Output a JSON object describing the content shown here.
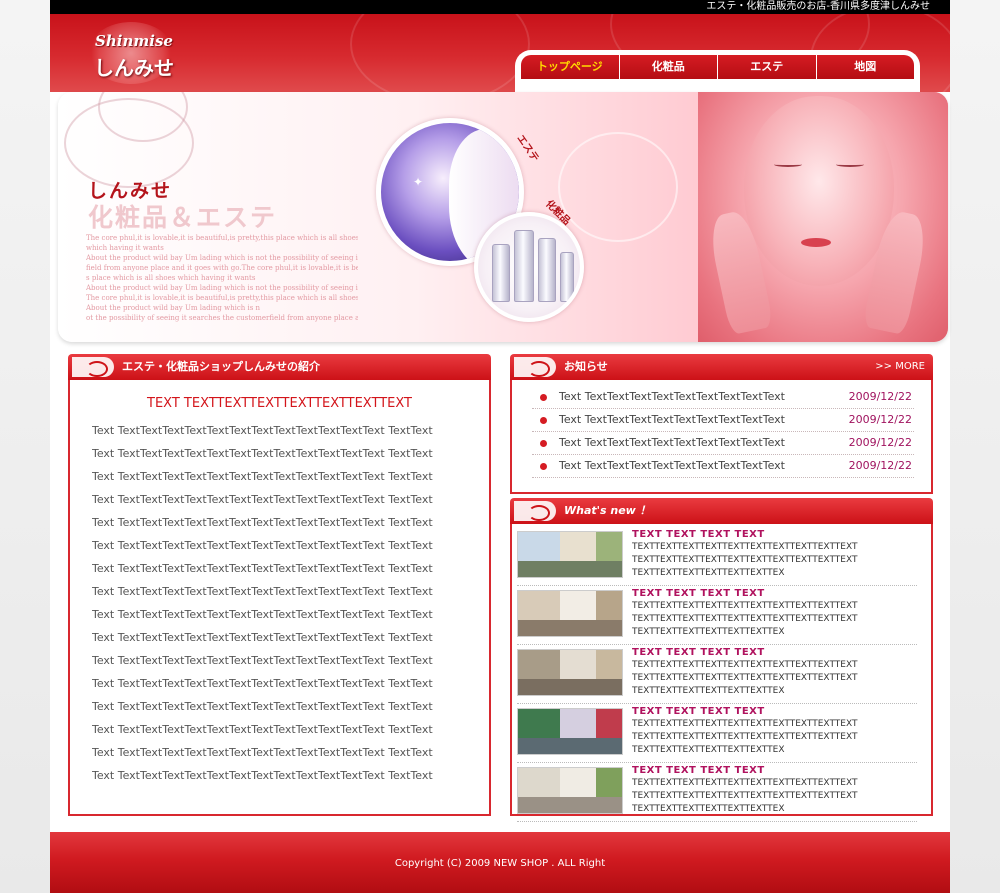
{
  "topbar": {
    "tagline": "エステ・化粧品販売のお店-香川県多度津しんみせ"
  },
  "logo": {
    "en": "Shinmise",
    "jp": "しんみせ"
  },
  "nav": {
    "items": [
      {
        "label": "トップページ"
      },
      {
        "label": "化粧品"
      },
      {
        "label": "エステ"
      },
      {
        "label": "地図"
      }
    ]
  },
  "hero": {
    "title": "しんみせ",
    "subtitle": "化粧品＆エステ",
    "tag_este": "エステ",
    "tag_kesho": "化粧品",
    "lines": [
      "The core phul,it is lovable,it is beautiful,is pretty,this place which is all shoes",
      " which having it wants",
      "About the product wild bay Um lading which is not the possibility of seeing i",
      "field from anyone place and it goes with go.The core phul,it is lovable,it is beautiful,i",
      "s place which is all shoes which having it wants",
      "About the product wild bay Um lading which is not the possibility of seeing it search",
      "The core phul,it is lovable,it is beautiful,is pretty,this place which is all shoes which",
      "About the product wild bay Um lading which is n",
      "ot the possibility of seeing it searches the  customerfield from anyone place and it go"
    ]
  },
  "intro": {
    "heading": "エステ・化粧品ショップしんみせの紹介",
    "title": "TEXT TEXTTEXTTEXTTEXTTEXTTEXTTEXT",
    "lines": [
      "Text TextTextTextTextTextTextTextTextTextTextTextText TextText",
      "Text TextTextTextTextTextTextTextTextTextTextTextText TextText",
      "Text TextTextTextTextTextTextTextTextTextTextTextText TextText",
      "Text TextTextTextTextTextTextTextTextTextTextTextText TextText",
      "Text TextTextTextTextTextTextTextTextTextTextTextText TextText",
      "Text TextTextTextTextTextTextTextTextTextTextTextText TextText",
      "Text TextTextTextTextTextTextTextTextTextTextTextText TextText",
      "Text TextTextTextTextTextTextTextTextTextTextTextText TextText",
      "Text TextTextTextTextTextTextTextTextTextTextTextText TextText",
      "Text TextTextTextTextTextTextTextTextTextTextTextText TextText",
      "Text TextTextTextTextTextTextTextTextTextTextTextText TextText",
      "Text TextTextTextTextTextTextTextTextTextTextTextText TextText",
      "Text TextTextTextTextTextTextTextTextTextTextTextText TextText",
      "Text TextTextTextTextTextTextTextTextTextTextTextText TextText",
      "Text TextTextTextTextTextTextTextTextTextTextTextText TextText",
      "Text TextTextTextTextTextTextTextTextTextTextTextText TextText"
    ]
  },
  "news": {
    "heading": "お知らせ",
    "more": ">> MORE",
    "items": [
      {
        "text": "Text TextTextTextTextTextTextTextTextText",
        "date": "2009/12/22"
      },
      {
        "text": "Text TextTextTextTextTextTextTextTextText",
        "date": "2009/12/22"
      },
      {
        "text": "Text TextTextTextTextTextTextTextTextText",
        "date": "2009/12/22"
      },
      {
        "text": "Text TextTextTextTextTextTextTextTextText",
        "date": "2009/12/22"
      }
    ]
  },
  "whatsnew": {
    "heading": "What's new ！",
    "items": [
      {
        "title": "TEXT TEXT TEXT TEXT",
        "l1": "TEXTTEXTTEXTTEXTTEXTTEXTTEXTTEXTTEXTTEXT",
        "l2": "TEXTTEXTTEXTTEXTTEXTTEXTTEXTTEXTTEXTTEXT",
        "l3": "TEXTTEXTTEXTTEXTTEXTTEXTTEX"
      },
      {
        "title": "TEXT TEXT TEXT TEXT",
        "l1": "TEXTTEXTTEXTTEXTTEXTTEXTTEXTTEXTTEXTTEXT",
        "l2": "TEXTTEXTTEXTTEXTTEXTTEXTTEXTTEXTTEXTTEXT",
        "l3": "TEXTTEXTTEXTTEXTTEXTTEXTTEX"
      },
      {
        "title": "TEXT TEXT TEXT TEXT",
        "l1": "TEXTTEXTTEXTTEXTTEXTTEXTTEXTTEXTTEXTTEXT",
        "l2": "TEXTTEXTTEXTTEXTTEXTTEXTTEXTTEXTTEXTTEXT",
        "l3": "TEXTTEXTTEXTTEXTTEXTTEXTTEX"
      },
      {
        "title": "TEXT TEXT TEXT TEXT",
        "l1": "TEXTTEXTTEXTTEXTTEXTTEXTTEXTTEXTTEXTTEXT",
        "l2": "TEXTTEXTTEXTTEXTTEXTTEXTTEXTTEXTTEXTTEXT",
        "l3": "TEXTTEXTTEXTTEXTTEXTTEXTTEX"
      },
      {
        "title": "TEXT TEXT TEXT TEXT",
        "l1": "TEXTTEXTTEXTTEXTTEXTTEXTTEXTTEXTTEXTTEXT",
        "l2": "TEXTTEXTTEXTTEXTTEXTTEXTTEXTTEXTTEXTTEXT",
        "l3": "TEXTTEXTTEXTTEXTTEXTTEXTTEX"
      }
    ]
  },
  "footer": {
    "copyright": "Copyright (C) 2009 NEW SHOP . ALL Right"
  },
  "colors": {
    "brand_red": "#d51c23",
    "date_purple": "#a0135f",
    "nav_active": "#ffd900"
  }
}
